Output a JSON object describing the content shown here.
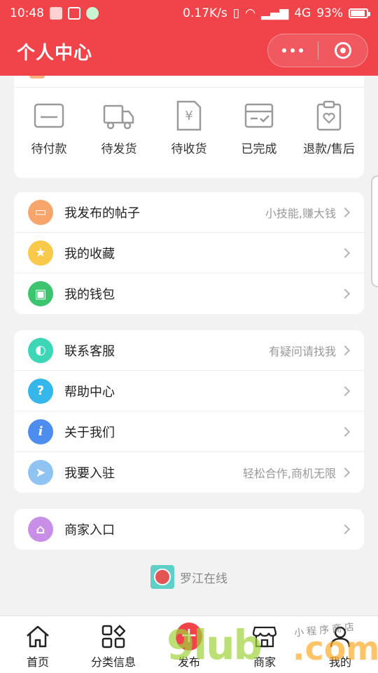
{
  "status_bar": {
    "time": "10:48",
    "speed": "0.17K/s",
    "network": "4G",
    "battery": "93%"
  },
  "header": {
    "title": "个人中心"
  },
  "orders": [
    {
      "label": "待付款",
      "icon": "wallet-icon"
    },
    {
      "label": "待发货",
      "icon": "truck-icon"
    },
    {
      "label": "待收货",
      "icon": "yuan-receipt-icon"
    },
    {
      "label": "已完成",
      "icon": "inbox-check-icon"
    },
    {
      "label": "退款/售后",
      "icon": "clipboard-heart-icon"
    }
  ],
  "group1": [
    {
      "label": "我发布的帖子",
      "extra": "小技能,赚大钱",
      "icon": "card-icon",
      "color": "#f7a56a"
    },
    {
      "label": "我的收藏",
      "extra": "",
      "icon": "star-icon",
      "color": "#f8c94a"
    },
    {
      "label": "我的钱包",
      "extra": "",
      "icon": "wallet-icon",
      "color": "#3cc46e"
    }
  ],
  "group2": [
    {
      "label": "联系客服",
      "extra": "有疑问请找我",
      "icon": "headset-icon",
      "color": "#3dd6b6"
    },
    {
      "label": "帮助中心",
      "extra": "",
      "icon": "question-icon",
      "color": "#35b7ec"
    },
    {
      "label": "关于我们",
      "extra": "",
      "icon": "info-icon",
      "color": "#4e8df0"
    },
    {
      "label": "我要入驻",
      "extra": "轻松合作,商机无限",
      "icon": "paper-plane-icon",
      "color": "#8fc3f2"
    }
  ],
  "group3": [
    {
      "label": "商家入口",
      "extra": "",
      "icon": "store-icon",
      "color": "#c88ee8"
    }
  ],
  "brand": {
    "text": "罗江在线"
  },
  "tabs": [
    {
      "label": "首页",
      "icon": "home-icon"
    },
    {
      "label": "分类信息",
      "icon": "grid-icon"
    },
    {
      "label": "发布",
      "icon": "plus-icon"
    },
    {
      "label": "商家",
      "icon": "store-icon"
    },
    {
      "label": "我的",
      "icon": "user-icon"
    }
  ],
  "watermark": {
    "main": "9lub",
    "domain": ".com",
    "tagline": "小程序商店"
  }
}
